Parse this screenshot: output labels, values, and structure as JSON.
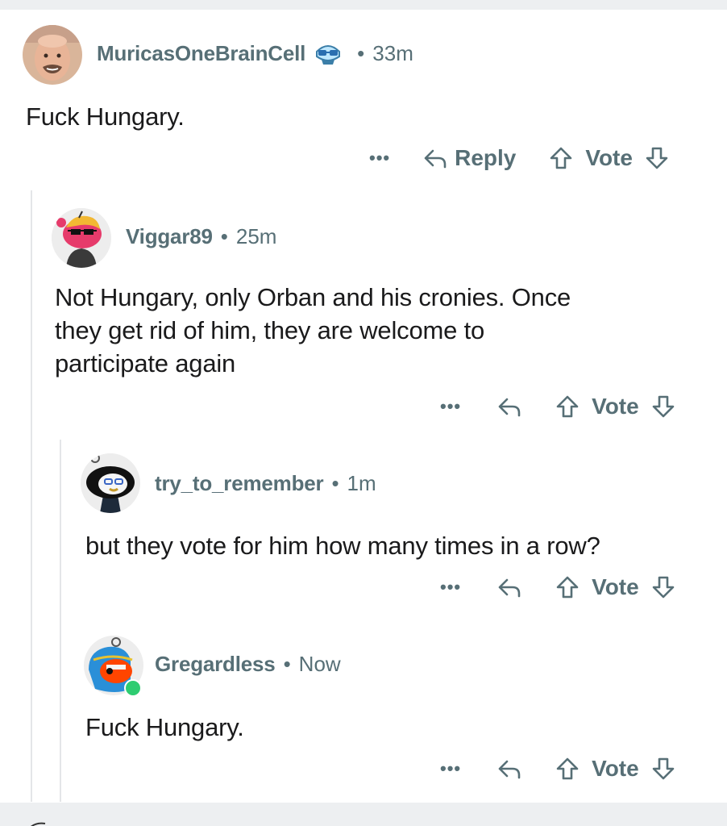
{
  "comments": [
    {
      "username": "MuricasOneBrainCell",
      "separator": "•",
      "time": "33m",
      "body": "Fuck Hungary.",
      "more": "•••",
      "reply_label": "Reply",
      "vote_label": "Vote"
    },
    {
      "username": "Viggar89",
      "separator": "•",
      "time": "25m",
      "body_lines": [
        "Not Hungary, only Orban and his cronies. Once",
        "they get rid of him, they are welcome to",
        "participate again"
      ],
      "more": "•••",
      "vote_label": "Vote"
    },
    {
      "username": "try_to_remember",
      "separator": "•",
      "time": "1m",
      "body": "but they vote for him how many times in a row?",
      "more": "•••",
      "vote_label": "Vote"
    },
    {
      "username": "Gregardless",
      "separator": "•",
      "time": "Now",
      "body": "Fuck Hungary.",
      "more": "•••",
      "vote_label": "Vote",
      "online": true
    }
  ],
  "colors": {
    "meta_text": "#576f76",
    "body_text": "#1a1a1b",
    "thread_line": "#e4e6e8",
    "online_dot": "#2ecc71",
    "divider": "#edeff1"
  }
}
